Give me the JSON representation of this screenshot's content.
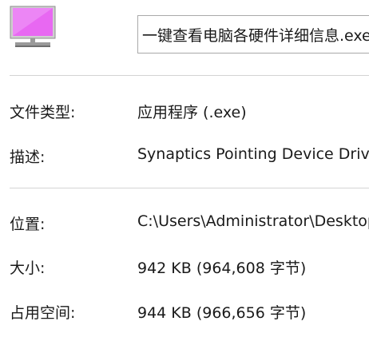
{
  "header": {
    "icon": "monitor-icon",
    "icon_color": "#e868f2",
    "filename": "一键查看电脑各硬件详细信息.exe"
  },
  "properties": {
    "type_label": "文件类型:",
    "type_value": "应用程序 (.exe)",
    "description_label": "描述:",
    "description_value": "Synaptics Pointing Device Driver",
    "location_label": "位置:",
    "location_value": "C:\\Users\\Administrator\\Desktop",
    "size_label": "大小:",
    "size_value": "942 KB (964,608 字节)",
    "disk_size_label": "占用空间:",
    "disk_size_value": "944 KB (966,656 字节)"
  }
}
